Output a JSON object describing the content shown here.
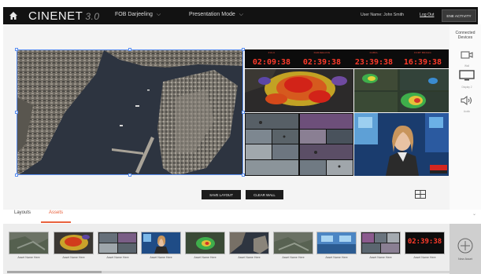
{
  "header": {
    "logo": "CINENET",
    "version": "3.0",
    "location": "FOB Darjeeling",
    "mode": "Presentation Mode",
    "user": "User Name: John Smith",
    "logout": "Log Out",
    "activity": "ENE ACTIVITY"
  },
  "devices": {
    "title_line1": "Connected",
    "title_line2": "Devices",
    "items": [
      {
        "label": "Wall",
        "icon": "camera-icon"
      },
      {
        "label": "Display 2",
        "icon": "monitor-icon"
      },
      {
        "label": "Audio",
        "icon": "speaker-icon"
      }
    ]
  },
  "clocks": [
    {
      "label": "ZULU",
      "time": "02:09:38"
    },
    {
      "label": "DARJEELING",
      "time": "02:39:38"
    },
    {
      "label": "KABUL",
      "time": "23:39:38"
    },
    {
      "label": "FORT BRAGG",
      "time": "16:39:38"
    }
  ],
  "actions": {
    "save_layout": "SAVE LAYOUT",
    "clear_wall": "CLEAR WALL"
  },
  "tabs": [
    {
      "label": "Layouts",
      "active": false
    },
    {
      "label": "Assets",
      "active": true
    }
  ],
  "assets": [
    {
      "name": "Asset Name Here",
      "kind": "satellite"
    },
    {
      "name": "Asset Name Here",
      "kind": "heatmap"
    },
    {
      "name": "Asset Name Here",
      "kind": "surveillance"
    },
    {
      "name": "Asset Name Here",
      "kind": "newscast"
    },
    {
      "name": "Asset Name Here",
      "kind": "radar-map"
    },
    {
      "name": "Asset Name Here",
      "kind": "aerial"
    },
    {
      "name": "Asset Name Here",
      "kind": "satellite"
    },
    {
      "name": "Asset Name Here",
      "kind": "studio"
    },
    {
      "name": "Asset Name Here",
      "kind": "surveillance"
    },
    {
      "name": "Asset Name Here",
      "kind": "clock",
      "time": "02:39:38"
    }
  ],
  "new_asset": "New Asset",
  "colors": {
    "accent": "#e8613c",
    "selection": "#5a8ef0",
    "clock": "#ff3b2b",
    "topbar": "#121212"
  }
}
